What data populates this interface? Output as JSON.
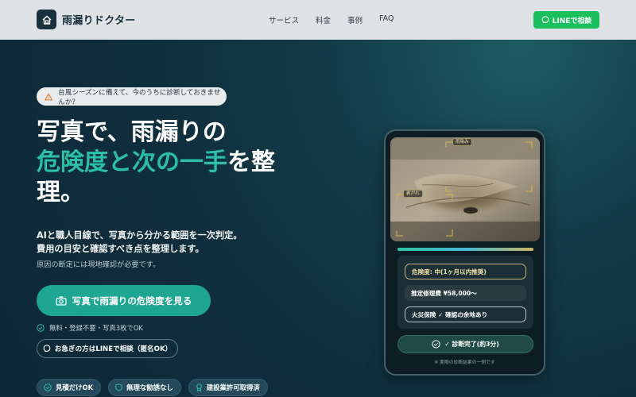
{
  "header": {
    "brand": "雨漏りドクター",
    "logo_icon": "house-icon",
    "nav": [
      "サービス",
      "料金",
      "事例",
      "FAQ"
    ],
    "line_button": "LINEで相談"
  },
  "hero": {
    "alert": "台風シーズンに備えて、今のうちに診断しておきませんか？",
    "headline_line1": "写真で、雨漏りの",
    "headline_accent": "危険度と次の一手",
    "headline_tail1": "を整",
    "headline_tail2": "理。",
    "sub_line1": "AIと職人目線で、写真から分かる範囲を一次判定。",
    "sub_line2": "費用の目安と確認すべき点を整理します。",
    "note": "原因の断定には現地確認が必要です。",
    "cta": "写真で雨漏りの危険度を見る",
    "free_note": "無料・登録不要・写真3枚でOK",
    "line_consult": "お急ぎの方はLINEで相談（匿名OK）",
    "badges": [
      "見積だけOK",
      "無理な勧誘なし",
      "建設業許可取得済"
    ]
  },
  "phone": {
    "tag_stain": "雨染み",
    "tag_peel": "剥がれ",
    "progress_fraction": 1.0,
    "danger": "危険度: 中(1ヶ月以内推奨)",
    "cost": "推定修理費 ¥58,000〜",
    "insurance": "火災保険 ✓ 確認の余地あり",
    "done": "✓ 診断完了(約3分)",
    "footnote": "※ 実際の診断結果の一例です"
  },
  "colors": {
    "accent": "#2bbfa8",
    "line_green": "#1bc05e",
    "cta": "#1ea693"
  }
}
